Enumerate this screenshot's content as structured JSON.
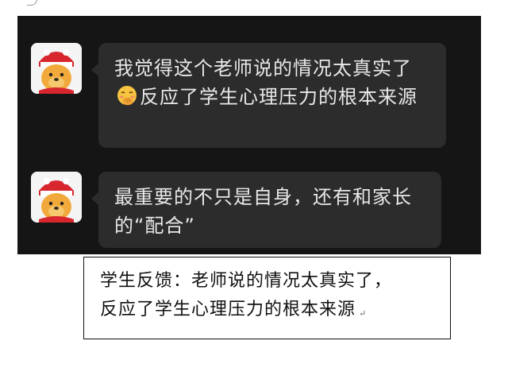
{
  "chat": {
    "messages": [
      {
        "avatar": "winnie-the-pooh-avatar",
        "text_before": "我觉得这个老师说的情况太真实了",
        "emoji": "face-with-hand-over-mouth",
        "text_after": "反应了学生心理压力的根本来源"
      },
      {
        "avatar": "winnie-the-pooh-avatar",
        "text": "最重要的不只是自身，还有和家长的“配合”"
      }
    ]
  },
  "caption": {
    "line1": "学生反馈：老师说的情况太真实了，",
    "line2": "反应了学生心理压力的根本来源",
    "paragraph_mark": "↵"
  },
  "colors": {
    "panel_bg": "#151515",
    "bubble_bg": "#2c2c2c",
    "bubble_text": "#e8e8e8",
    "caption_border": "#111111"
  }
}
